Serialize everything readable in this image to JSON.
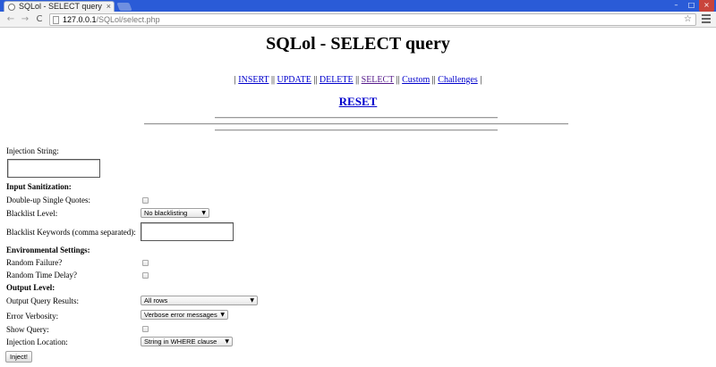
{
  "browser": {
    "tab_title": "SQLol - SELECT query",
    "tab_close": "×",
    "url_host": "127.0.0.1",
    "url_path": "/SQLol/select.php",
    "back_glyph": "←",
    "forward_glyph": "→",
    "reload_glyph": "C",
    "star_glyph": "☆",
    "win_minimize": "–",
    "win_maximize": "□",
    "win_close": "×"
  },
  "page": {
    "title": "SQLol - SELECT query",
    "nav": {
      "sep_start": "|",
      "insert": "INSERT",
      "sep1": "||",
      "update": "UPDATE",
      "sep2": "||",
      "delete": "DELETE",
      "sep3": "||",
      "select": "SELECT",
      "sep4": "||",
      "custom": "Custom",
      "sep5": "||",
      "challenges": "Challenges",
      "sep_end": "|"
    },
    "reset": "RESET"
  },
  "form": {
    "injection_string_label": "Injection String:",
    "input_sanitization_heading": "Input Sanitization:",
    "double_up_label": "Double-up Single Quotes:",
    "blacklist_level_label": "Blacklist Level:",
    "blacklist_level_value": "No blacklisting",
    "blacklist_keywords_label": "Blacklist Keywords (comma separated):",
    "environmental_heading": "Environmental Settings:",
    "random_failure_label": "Random Failure?",
    "random_delay_label": "Random Time Delay?",
    "output_level_heading": "Output Level:",
    "output_query_results_label": "Output Query Results:",
    "output_query_results_value": "All rows",
    "error_verbosity_label": "Error Verbosity:",
    "error_verbosity_value": "Verbose error messages",
    "show_query_label": "Show Query:",
    "injection_location_label": "Injection Location:",
    "injection_location_value": "String in WHERE clause",
    "submit_label": "Inject!"
  },
  "icons": {
    "select_arrow": "▼"
  }
}
